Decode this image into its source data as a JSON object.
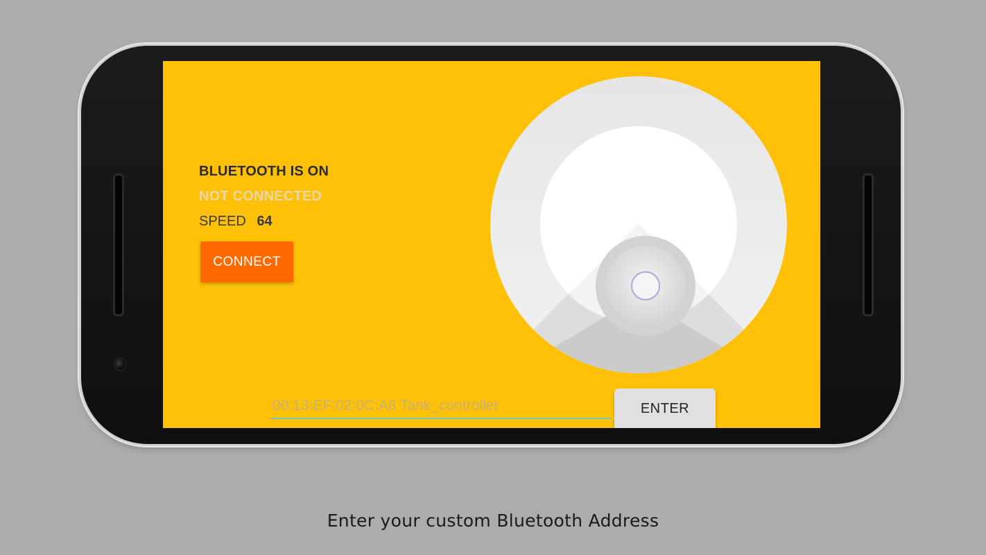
{
  "status": {
    "bluetooth": "BLUETOOTH IS ON",
    "connection": "NOT CONNECTED",
    "speed_label": "SPEED",
    "speed_value": "64"
  },
  "buttons": {
    "connect_label": "CONNECT",
    "enter_label": "ENTER"
  },
  "address_field": {
    "placeholder": "00:13:EF:02:0C:A8 Tank_controller"
  },
  "caption": "Enter your custom Bluetooth Address",
  "colors": {
    "screen_background": "#ffc107",
    "connect_button": "#ff6a00",
    "enter_button": "#e0e0e0",
    "input_underline": "#6fc7c2"
  },
  "icons": {
    "joystick": "joystick-control"
  }
}
